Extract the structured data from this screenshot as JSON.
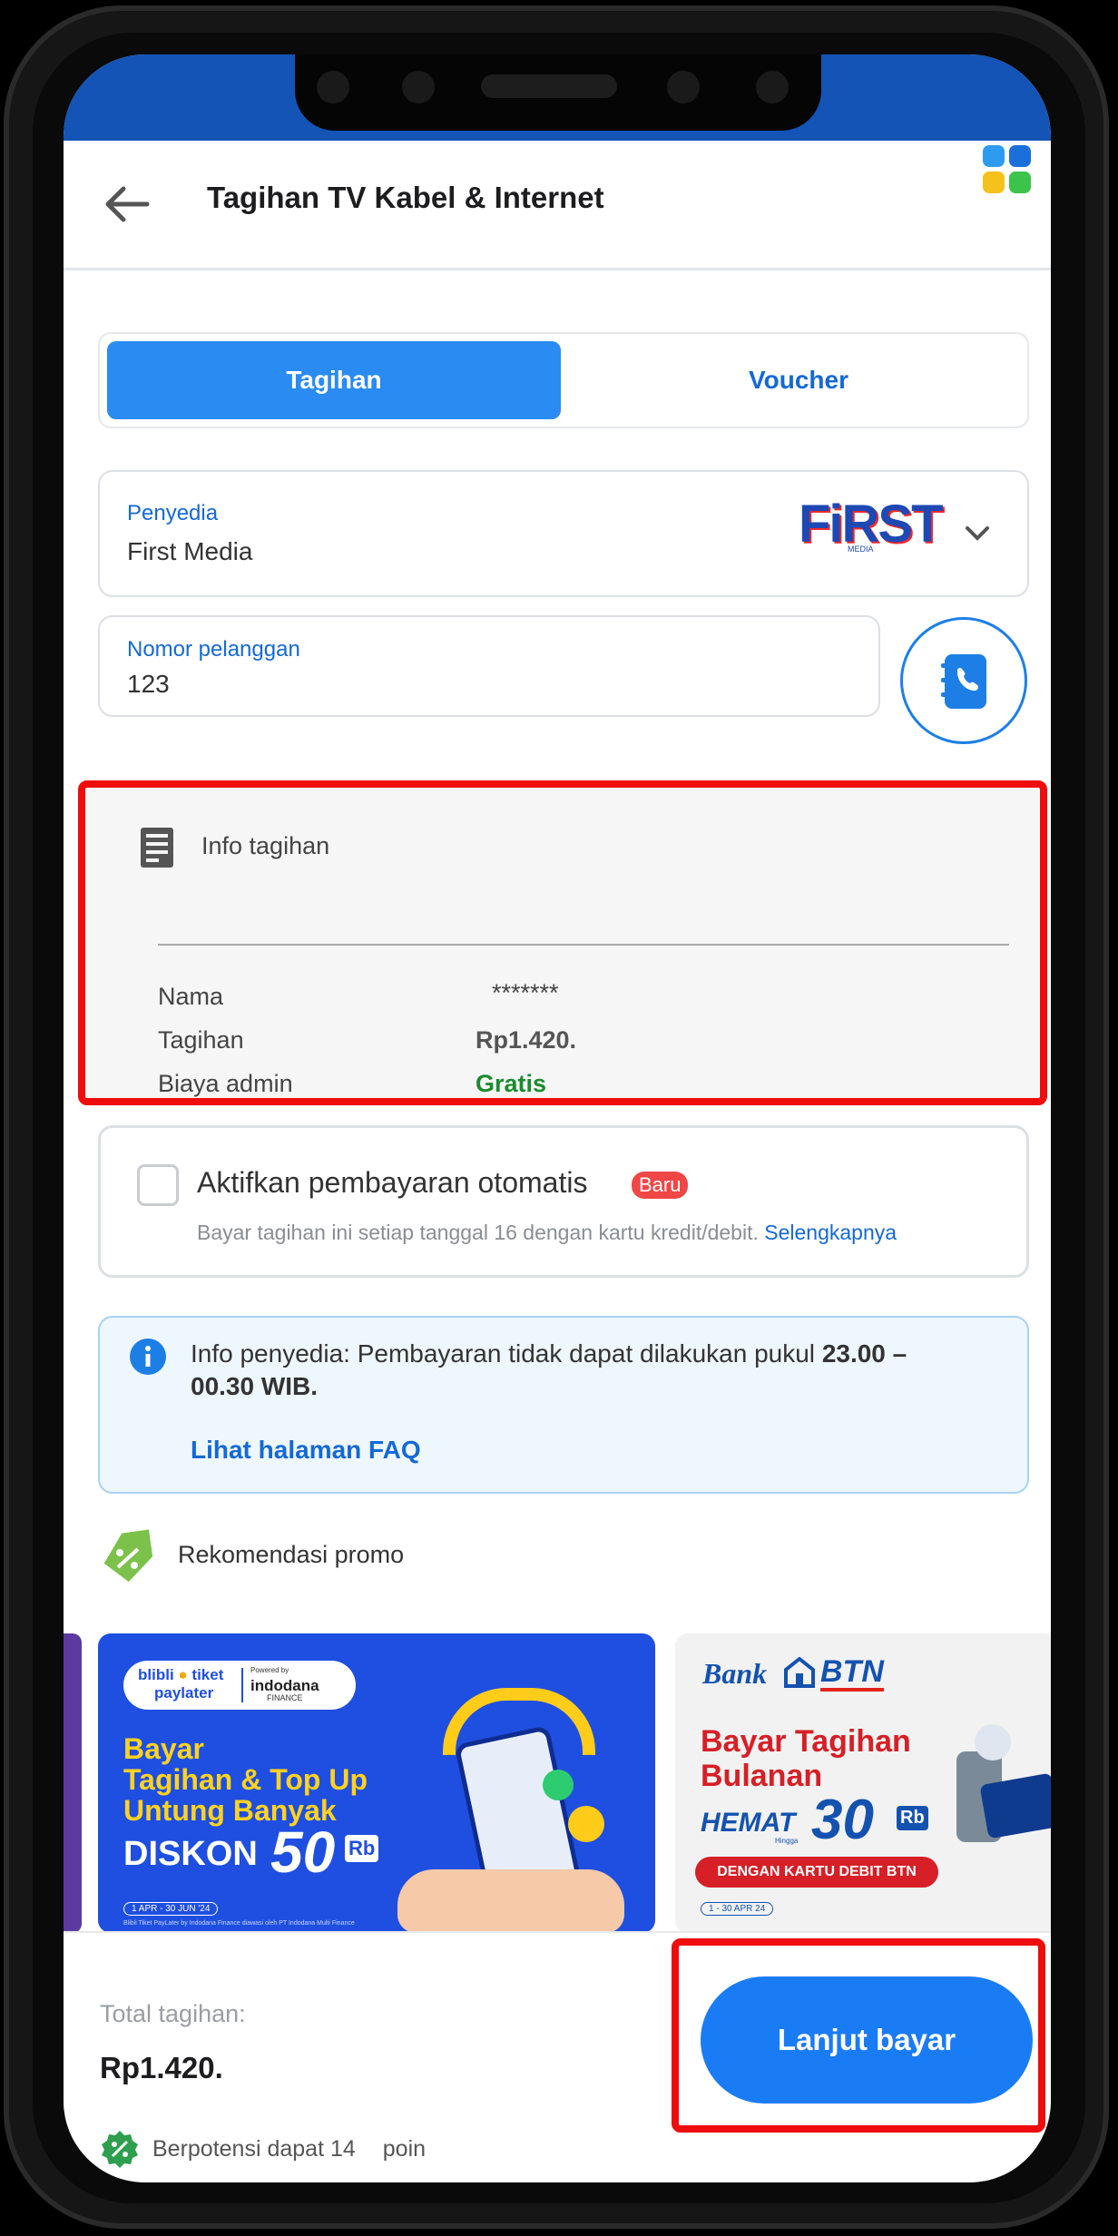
{
  "header": {
    "title": "Tagihan TV Kabel & Internet"
  },
  "tabs": [
    {
      "label": "Tagihan",
      "active": true
    },
    {
      "label": "Voucher",
      "active": false
    }
  ],
  "provider": {
    "label": "Penyedia",
    "value": "First Media",
    "logo_text": "FiRST",
    "logo_sub": "MEDIA"
  },
  "customer": {
    "label": "Nomor pelanggan",
    "value": "123"
  },
  "bill_info": {
    "title": "Info tagihan",
    "rows": [
      {
        "key": "Nama",
        "value": "*******"
      },
      {
        "key": "Tagihan",
        "value": "Rp1.420."
      },
      {
        "key": "Biaya admin",
        "value": "Gratis"
      }
    ]
  },
  "autopay": {
    "label": "Aktifkan pembayaran otomatis",
    "badge": "Baru",
    "desc": "Bayar tagihan ini setiap tanggal 16 dengan kartu kredit/debit.",
    "link": "Selengkapnya"
  },
  "notice": {
    "text": "Info penyedia: Pembayaran tidak dapat dilakukan pukul ",
    "time_line1": "23.00 –",
    "time_line2": "00.30 WIB.",
    "link": "Lihat halaman FAQ"
  },
  "promo": {
    "heading": "Rekomendasi promo",
    "card1": {
      "brand1": "blibli",
      "brand2": "tiket",
      "brand3": "paylater",
      "powered": "Powered by",
      "partner": "indodana",
      "partner_sub": "FINANCE",
      "line1": "Bayar",
      "line2": "Tagihan & Top Up",
      "line3": "Untung Banyak",
      "diskon": "DISKON",
      "amount": "50",
      "unit": "Rb",
      "period": "1 APR - 30 JUN '24",
      "fine": "Blibli Tiket PayLater by Indodana Finance diawasi oleh PT Indodana Multi Finance"
    },
    "card2": {
      "bank": "Bank",
      "brand": "BTN",
      "line1": "Bayar Tagihan",
      "line2": "Bulanan",
      "hemat": "HEMAT",
      "hingga": "Hingga",
      "amount": "30",
      "unit": "Rb",
      "ribbon": "DENGAN KARTU DEBIT BTN",
      "period": "1 - 30 APR 24"
    }
  },
  "footer": {
    "total_label": "Total tagihan:",
    "total_value": "Rp1.420.",
    "points_prefix": "Berpotensi dapat 14",
    "points_suffix": "poin",
    "pay_button": "Lanjut bayar"
  },
  "colors": {
    "primary": "#1a7cf5",
    "highlight": "#ee0c0c",
    "success": "#1b8a2e",
    "status_bar": "#1354b6"
  }
}
